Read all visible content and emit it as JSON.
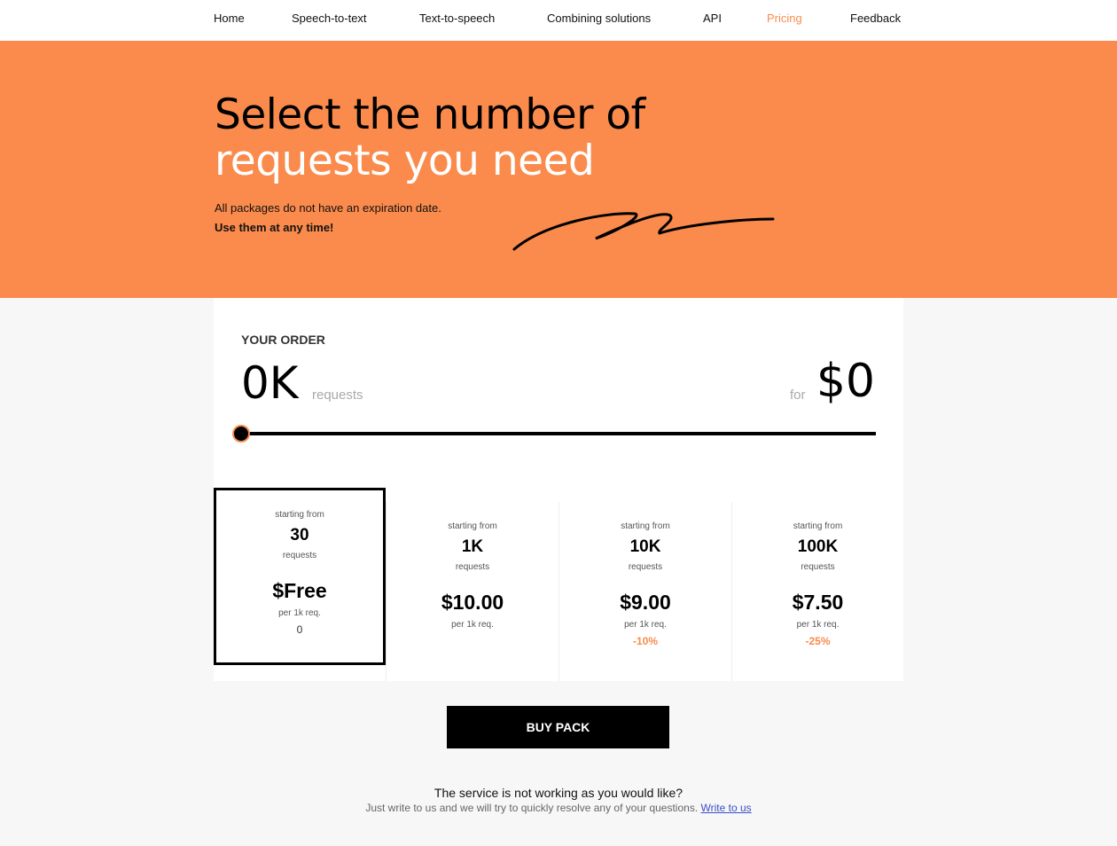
{
  "nav": {
    "items": [
      "Home",
      "Speech-to-text",
      "Text-to-speech",
      "Combining solutions",
      "API",
      "Pricing",
      "Feedback"
    ],
    "active": "Pricing"
  },
  "hero": {
    "title_line1": "Select the number of",
    "title_line2": "requests you need",
    "subtitle1": "All packages do not have an expiration date.",
    "subtitle2": "Use them at any time!"
  },
  "order": {
    "label": "YOUR ORDER",
    "quantity": "0K",
    "quantity_unit": "requests",
    "for_label": "for",
    "price": "$0",
    "slider_value": 0
  },
  "packs": [
    {
      "starting": "starting from",
      "count": "30",
      "unit": "requests",
      "price": "$Free",
      "per": "per 1k req.",
      "discount": "0"
    },
    {
      "starting": "starting from",
      "count": "1K",
      "unit": "requests",
      "price": "$10.00",
      "per": "per 1k req.",
      "discount": ""
    },
    {
      "starting": "starting from",
      "count": "10K",
      "unit": "requests",
      "price": "$9.00",
      "per": "per 1k req.",
      "discount": "-10%"
    },
    {
      "starting": "starting from",
      "count": "100K",
      "unit": "requests",
      "price": "$7.50",
      "per": "per 1k req.",
      "discount": "-25%"
    }
  ],
  "buy": {
    "label": "BUY PACK"
  },
  "footer": {
    "title": "The service is not working as you would like?",
    "text": "Just write to us and we will try to quickly resolve any of your questions.",
    "link": "Write to us"
  },
  "colors": {
    "accent": "#fa8b4c",
    "link": "#3b4fc6"
  }
}
